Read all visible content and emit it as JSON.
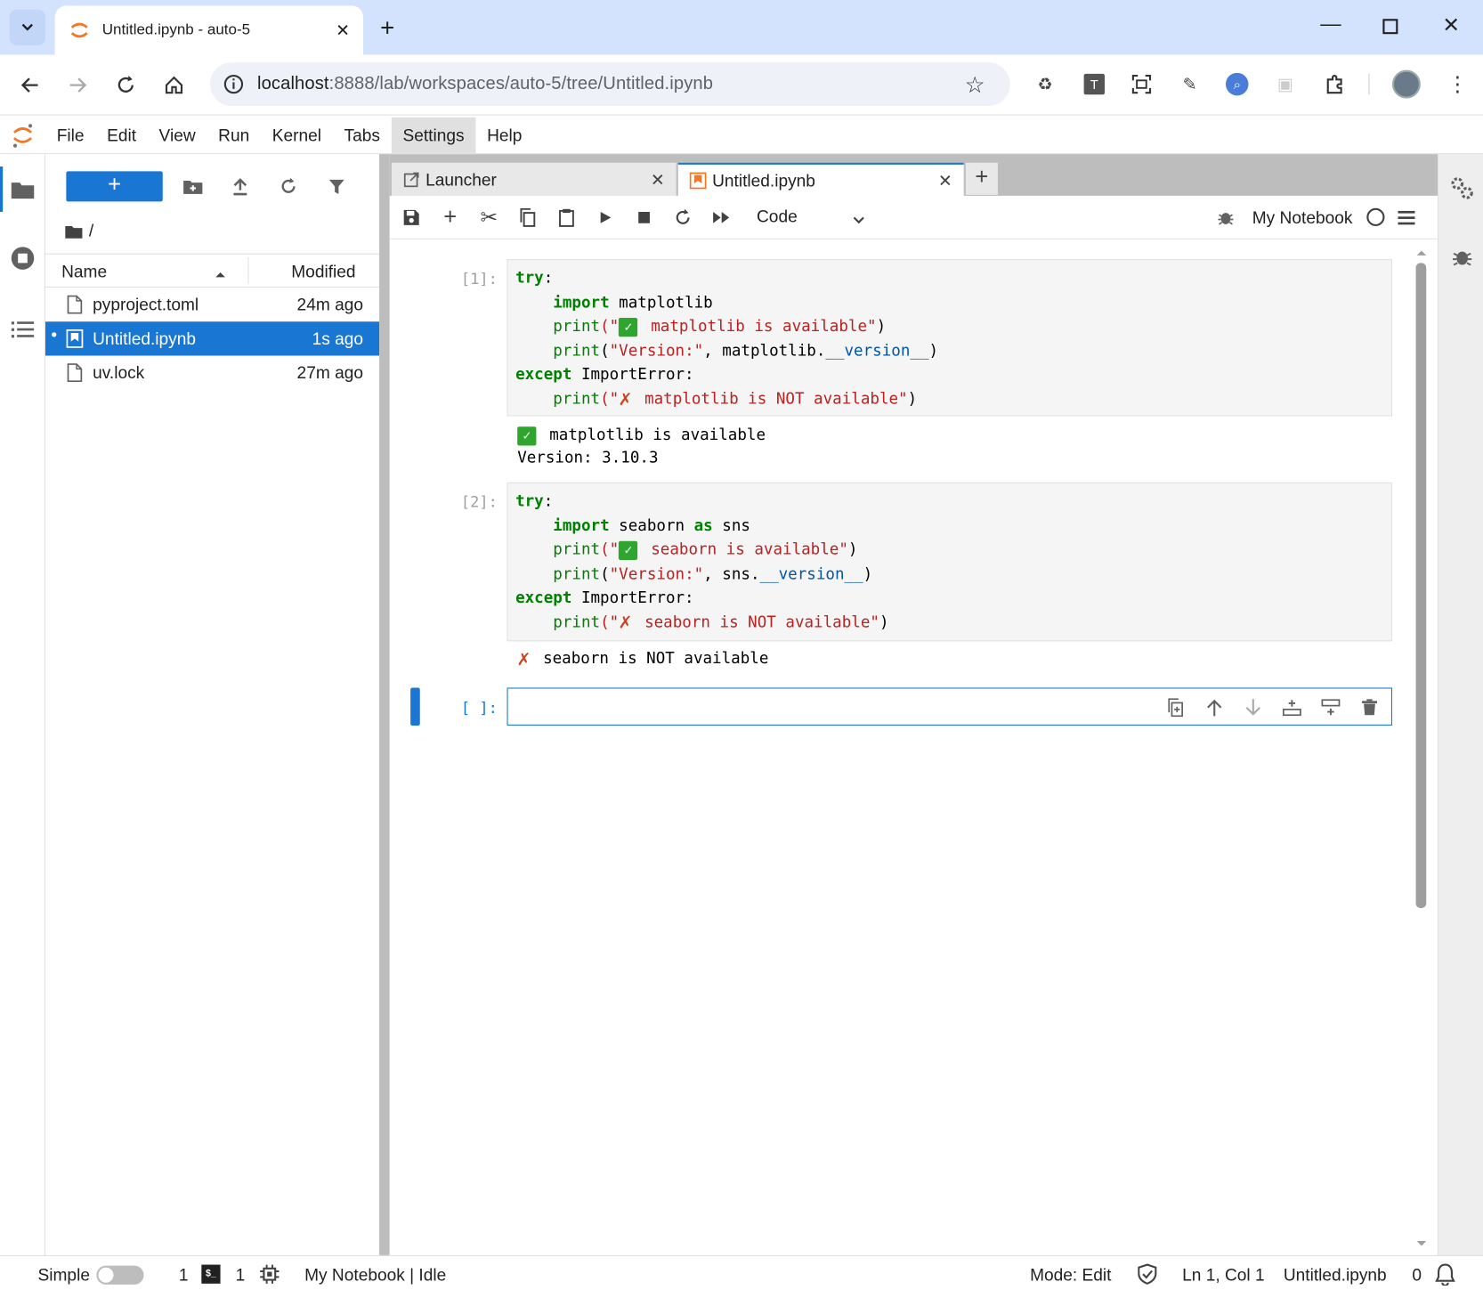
{
  "browser": {
    "tab_title": "Untitled.ipynb - auto-5",
    "url_host": "localhost",
    "url_rest": ":8888/lab/workspaces/auto-5/tree/Untitled.ipynb",
    "new_tab": "+",
    "ext_t_label": "T"
  },
  "menu": [
    "File",
    "Edit",
    "View",
    "Run",
    "Kernel",
    "Tabs",
    "Settings",
    "Help"
  ],
  "filebrowser": {
    "new_label": "+",
    "path": "/",
    "col_name": "Name",
    "col_modified": "Modified",
    "files": [
      {
        "name": "pyproject.toml",
        "modified": "24m ago"
      },
      {
        "name": "Untitled.ipynb",
        "modified": "1s ago"
      },
      {
        "name": "uv.lock",
        "modified": "27m ago"
      }
    ]
  },
  "tabs": {
    "launcher": "Launcher",
    "notebook": "Untitled.ipynb",
    "add": "+"
  },
  "nbtoolbar": {
    "cell_type": "Code",
    "kernel": "My Notebook"
  },
  "cells": {
    "c1_prompt": "[1]:",
    "c2_prompt": "[2]:",
    "c3_prompt": "[ ]:",
    "c1": {
      "l1_kw": "try",
      "l1_p": ":",
      "l2_kw": "import",
      "l2_mod": " matplotlib",
      "l3_fn": "print",
      "l3_a": "(\"",
      "l3_s": " matplotlib is available\"",
      "l3_b": ")",
      "l4_fn": "print",
      "l4_a": "(",
      "l4_s": "\"Version:\"",
      "l4_b": ", matplotlib.",
      "l4_d": "__version__",
      "l4_c": ")",
      "l5_kw": "except",
      "l5_p": " ImportError:",
      "l6_fn": "print",
      "l6_a": "(\"",
      "l6_s": " matplotlib is NOT available\"",
      "l6_b": ")"
    },
    "c1_out1": "matplotlib is available",
    "c1_out2": "Version: 3.10.3",
    "c2": {
      "l1_kw": "try",
      "l1_p": ":",
      "l2_kw": "import",
      "l2_mod": " seaborn ",
      "l2_as": "as",
      "l2_alias": " sns",
      "l3_fn": "print",
      "l3_a": "(\"",
      "l3_s": " seaborn is available\"",
      "l3_b": ")",
      "l4_fn": "print",
      "l4_a": "(",
      "l4_s": "\"Version:\"",
      "l4_b": ", sns.",
      "l4_d": "__version__",
      "l4_c": ")",
      "l5_kw": "except",
      "l5_p": " ImportError:",
      "l6_fn": "print",
      "l6_a": "(\"",
      "l6_s": " seaborn is NOT available\"",
      "l6_b": ")"
    },
    "c2_out1": "seaborn is NOT available"
  },
  "status": {
    "simple": "Simple",
    "terminals": "1",
    "kernels": "1",
    "kernel_status": "My Notebook | Idle",
    "mode": "Mode: Edit",
    "position": "Ln 1, Col 1",
    "filename": "Untitled.ipynb",
    "notifications": "0"
  },
  "colors": {
    "accent": "#1976d2",
    "jupyter_orange": "#f37726",
    "browser_tabstrip": "#d3e3fd"
  }
}
